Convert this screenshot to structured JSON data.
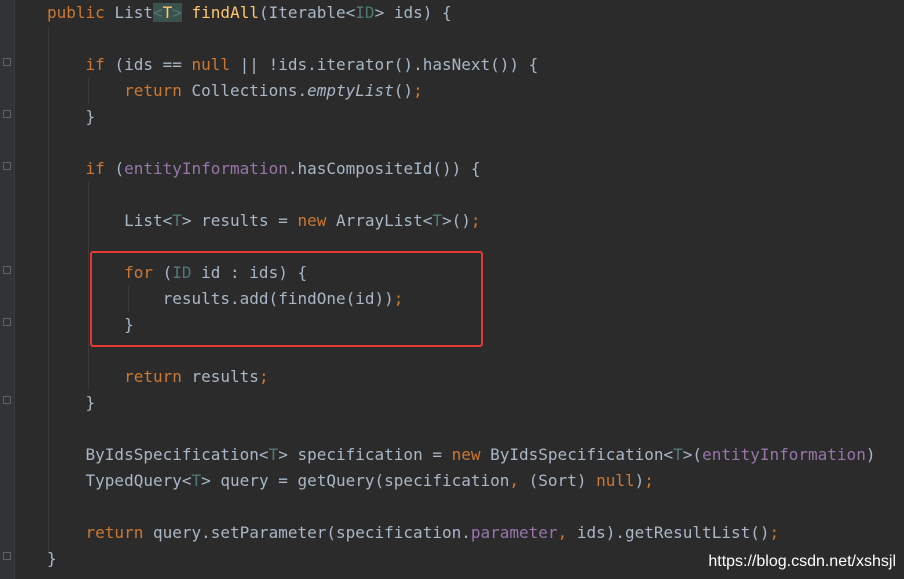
{
  "code_lines": [
    {
      "id": "l1",
      "tokens": [
        [
          "kw",
          "public "
        ],
        [
          "plain",
          "List"
        ],
        [
          "genhl",
          "<"
        ],
        [
          "genhly",
          "T"
        ],
        [
          "genhl",
          ">"
        ],
        [
          "plain",
          " "
        ],
        [
          "fn",
          "findAll"
        ],
        [
          "plain",
          "(Iterable<"
        ],
        [
          "tp",
          "ID"
        ],
        [
          "plain",
          "> ids) {"
        ]
      ]
    },
    {
      "id": "l2",
      "tokens": []
    },
    {
      "id": "l3",
      "tokens": [
        [
          "plain",
          "    "
        ],
        [
          "kw",
          "if "
        ],
        [
          "plain",
          "(ids == "
        ],
        [
          "kw",
          "null "
        ],
        [
          "plain",
          "|| !ids.iterator().hasNext()) {"
        ]
      ]
    },
    {
      "id": "l4",
      "tokens": [
        [
          "plain",
          "        "
        ],
        [
          "kw",
          "return "
        ],
        [
          "plain",
          "Collections."
        ],
        [
          "italic",
          "emptyList"
        ],
        [
          "plain",
          "()"
        ],
        [
          "kw",
          ";"
        ]
      ]
    },
    {
      "id": "l5",
      "tokens": [
        [
          "plain",
          "    }"
        ]
      ]
    },
    {
      "id": "l6",
      "tokens": []
    },
    {
      "id": "l7",
      "tokens": [
        [
          "plain",
          "    "
        ],
        [
          "kw",
          "if "
        ],
        [
          "plain",
          "("
        ],
        [
          "field",
          "entityInformation"
        ],
        [
          "plain",
          ".hasCompositeId()) {"
        ]
      ]
    },
    {
      "id": "l8",
      "tokens": []
    },
    {
      "id": "l9",
      "tokens": [
        [
          "plain",
          "        List<"
        ],
        [
          "tp",
          "T"
        ],
        [
          "plain",
          "> results = "
        ],
        [
          "kw",
          "new "
        ],
        [
          "plain",
          "ArrayList<"
        ],
        [
          "tp",
          "T"
        ],
        [
          "plain",
          ">()"
        ],
        [
          "kw",
          ";"
        ]
      ]
    },
    {
      "id": "l10",
      "tokens": []
    },
    {
      "id": "l11",
      "tokens": [
        [
          "plain",
          "        "
        ],
        [
          "kw",
          "for "
        ],
        [
          "plain",
          "("
        ],
        [
          "tp",
          "ID"
        ],
        [
          "plain",
          " id : ids) {"
        ]
      ]
    },
    {
      "id": "l12",
      "tokens": [
        [
          "plain",
          "            results.add(findOne(id))"
        ],
        [
          "kw",
          ";"
        ]
      ]
    },
    {
      "id": "l13",
      "tokens": [
        [
          "plain",
          "        }"
        ]
      ]
    },
    {
      "id": "l14",
      "tokens": []
    },
    {
      "id": "l15",
      "tokens": [
        [
          "plain",
          "        "
        ],
        [
          "kw",
          "return "
        ],
        [
          "plain",
          "results"
        ],
        [
          "kw",
          ";"
        ]
      ]
    },
    {
      "id": "l16",
      "tokens": [
        [
          "plain",
          "    }"
        ]
      ]
    },
    {
      "id": "l17",
      "tokens": []
    },
    {
      "id": "l18",
      "tokens": [
        [
          "plain",
          "    ByIdsSpecification<"
        ],
        [
          "tp",
          "T"
        ],
        [
          "plain",
          "> specification = "
        ],
        [
          "kw",
          "new "
        ],
        [
          "plain",
          "ByIdsSpecification<"
        ],
        [
          "tp",
          "T"
        ],
        [
          "plain",
          ">("
        ],
        [
          "field",
          "entityInformation"
        ],
        [
          "plain",
          ")"
        ]
      ]
    },
    {
      "id": "l19",
      "tokens": [
        [
          "plain",
          "    TypedQuery<"
        ],
        [
          "tp",
          "T"
        ],
        [
          "plain",
          "> query = getQuery(specification"
        ],
        [
          "kw",
          ", "
        ],
        [
          "plain",
          "(Sort) "
        ],
        [
          "kw",
          "null"
        ],
        [
          "plain",
          ")"
        ],
        [
          "kw",
          ";"
        ]
      ]
    },
    {
      "id": "l20",
      "tokens": []
    },
    {
      "id": "l21",
      "tokens": [
        [
          "plain",
          "    "
        ],
        [
          "kw",
          "return "
        ],
        [
          "plain",
          "query.setParameter(specification."
        ],
        [
          "field",
          "parameter"
        ],
        [
          "kw",
          ", "
        ],
        [
          "plain",
          "ids).getResultList()"
        ],
        [
          "kw",
          ";"
        ]
      ]
    },
    {
      "id": "l22",
      "tokens": [
        [
          "plain",
          "}"
        ]
      ]
    }
  ],
  "watermark": "https://blog.csdn.net/xshsjl",
  "colors": {
    "background": "#2b2b2b",
    "keyword": "#cc7832",
    "function": "#ffc66d",
    "type_param": "#507874",
    "field": "#9876aa",
    "plain": "#a9b7c6",
    "highlight_box": "#e53935"
  }
}
